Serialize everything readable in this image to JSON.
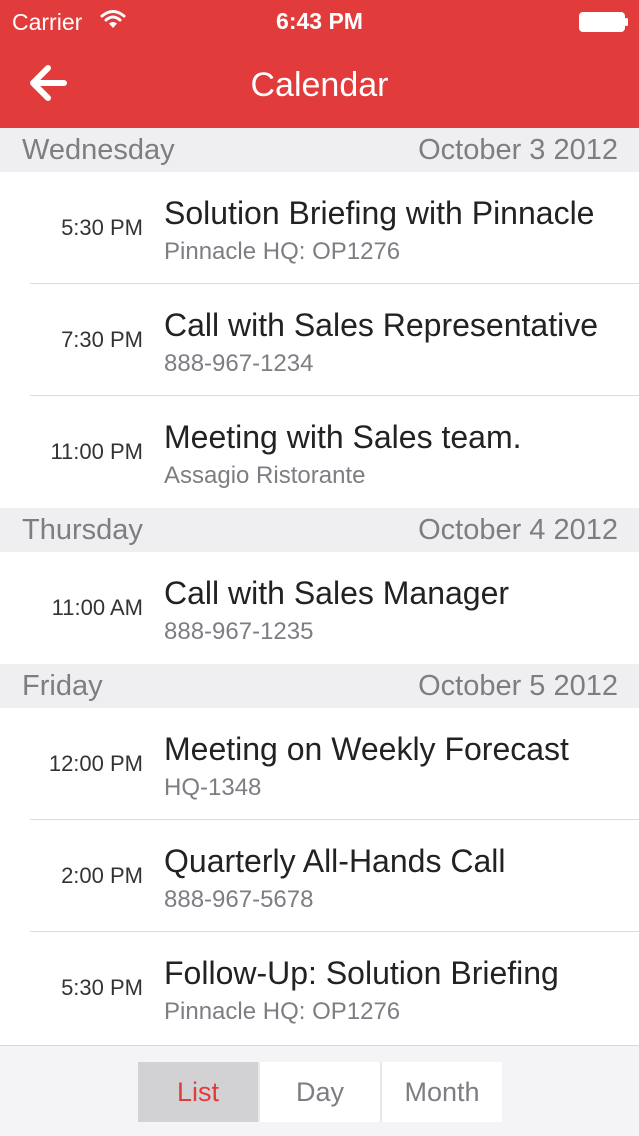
{
  "status_bar": {
    "carrier": "Carrier",
    "time": "6:43 PM",
    "wifi_icon": "wifi-icon",
    "battery_icon": "battery-icon"
  },
  "nav_bar": {
    "title": "Calendar",
    "back_icon": "arrow-left-icon",
    "background_color": "#e23b3b"
  },
  "sections": [
    {
      "day": "Wednesday",
      "date": "October 3 2012",
      "events": [
        {
          "time": "5:30 PM",
          "title": "Solution Briefing with Pinnacle",
          "subtitle": "Pinnacle HQ: OP1276"
        },
        {
          "time": "7:30 PM",
          "title": "Call with Sales Representative",
          "subtitle": "888-967-1234"
        },
        {
          "time": "11:00 PM",
          "title": "Meeting with Sales team.",
          "subtitle": "Assagio Ristorante"
        }
      ]
    },
    {
      "day": "Thursday",
      "date": "October 4 2012",
      "events": [
        {
          "time": "11:00 AM",
          "title": "Call with Sales Manager",
          "subtitle": "888-967-1235"
        }
      ]
    },
    {
      "day": "Friday",
      "date": "October 5 2012",
      "events": [
        {
          "time": "12:00 PM",
          "title": "Meeting on Weekly Forecast",
          "subtitle": "HQ-1348"
        },
        {
          "time": "2:00 PM",
          "title": "Quarterly All-Hands Call",
          "subtitle": "888-967-5678"
        },
        {
          "time": "5:30 PM",
          "title": "Follow-Up: Solution Briefing",
          "subtitle": "Pinnacle HQ: OP1276"
        }
      ]
    }
  ],
  "toolbar": {
    "segments": [
      {
        "label": "List",
        "selected": true
      },
      {
        "label": "Day",
        "selected": false
      },
      {
        "label": "Month",
        "selected": false
      }
    ],
    "selected_color": "#e23b3b"
  }
}
